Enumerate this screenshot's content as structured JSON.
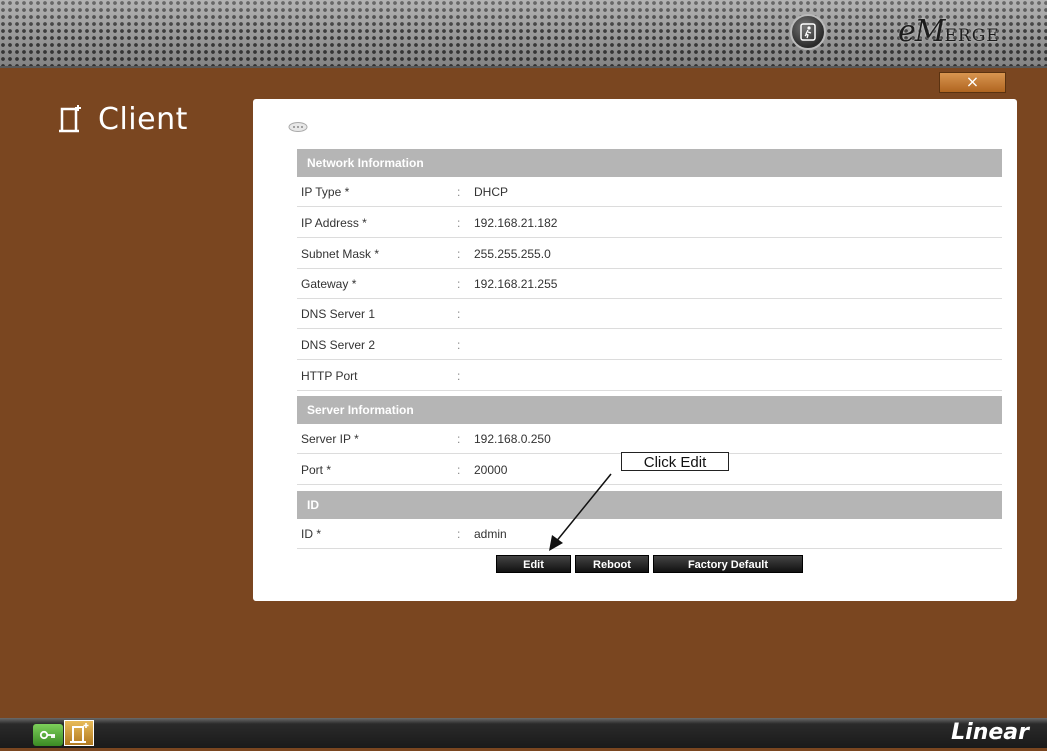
{
  "header": {
    "brand_main": "eM",
    "brand_suffix": "ERGE"
  },
  "toolbar": {
    "close_label": "×"
  },
  "page": {
    "title": "Client"
  },
  "sections": {
    "network": {
      "header": "Network Information",
      "rows": [
        {
          "label": "IP Type *",
          "value": "DHCP"
        },
        {
          "label": "IP Address *",
          "value": "192.168.21.182"
        },
        {
          "label": "Subnet Mask *",
          "value": "255.255.255.0"
        },
        {
          "label": "Gateway *",
          "value": "192.168.21.255"
        },
        {
          "label": "DNS Server 1",
          "value": ""
        },
        {
          "label": "DNS Server 2",
          "value": ""
        },
        {
          "label": "HTTP Port",
          "value": ""
        }
      ]
    },
    "server": {
      "header": "Server Information",
      "rows": [
        {
          "label": "Server IP *",
          "value": "192.168.0.250"
        },
        {
          "label": "Port *",
          "value": "20000"
        }
      ]
    },
    "id": {
      "header": "ID",
      "rows": [
        {
          "label": "ID *",
          "value": "admin"
        }
      ]
    }
  },
  "colon": ":",
  "actions": {
    "edit": "Edit",
    "reboot": "Reboot",
    "factory_default": "Factory Default"
  },
  "annotation": {
    "text": "Click Edit"
  },
  "footer": {
    "brand": "Linear"
  }
}
